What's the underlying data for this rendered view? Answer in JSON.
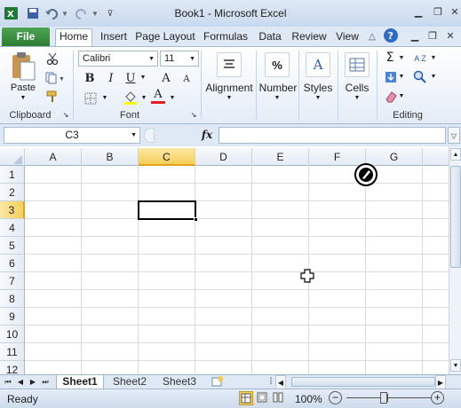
{
  "window": {
    "title": "Book1 - Microsoft Excel"
  },
  "tabs": {
    "file": "File",
    "home": "Home",
    "insert": "Insert",
    "page_layout": "Page Layout",
    "formulas": "Formulas",
    "data": "Data",
    "review": "Review",
    "view": "View"
  },
  "ribbon": {
    "clipboard": {
      "label": "Clipboard",
      "paste": "Paste"
    },
    "font": {
      "label": "Font",
      "name": "Calibri",
      "size": "11",
      "bold": "B",
      "italic": "I",
      "underline": "U",
      "grow": "A",
      "shrink": "A",
      "font_color": "A"
    },
    "alignment": {
      "label": "Alignment"
    },
    "number": {
      "label": "Number",
      "glyph": "%"
    },
    "styles": {
      "label": "Styles",
      "glyph": "A"
    },
    "cells": {
      "label": "Cells"
    },
    "editing": {
      "label": "Editing",
      "sum": "Σ",
      "sort": "A Z"
    }
  },
  "formula_bar": {
    "name_box": "C3",
    "fx": "fx",
    "value": ""
  },
  "grid": {
    "columns": [
      "A",
      "B",
      "C",
      "D",
      "E",
      "F",
      "G"
    ],
    "rows": [
      "1",
      "2",
      "3",
      "4",
      "5",
      "6",
      "7",
      "8",
      "9",
      "10",
      "11",
      "12"
    ],
    "active_cell": "C3"
  },
  "sheets": [
    "Sheet1",
    "Sheet2",
    "Sheet3"
  ],
  "status": {
    "ready": "Ready",
    "zoom": "100%",
    "minus": "−",
    "plus": "+"
  },
  "colors": {
    "accent_green": "#2b7c31",
    "active_header": "#f9d96a",
    "ribbon_blue": "#dfe9f5"
  }
}
